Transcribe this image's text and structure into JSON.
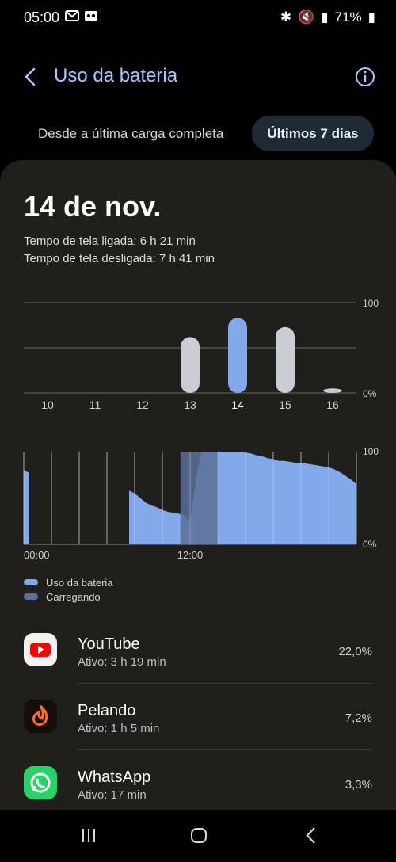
{
  "status": {
    "time": "05:00",
    "battery": "71%"
  },
  "header": {
    "title": "Uso da bateria",
    "icons": [
      "back-arrow-icon",
      "info-icon"
    ]
  },
  "tabs": [
    {
      "label": "Desde a última carga completa"
    },
    {
      "label": "Últimos 7 dias"
    }
  ],
  "summary": {
    "date": "14 de nov.",
    "screen_on": "Tempo de tela ligada: 6 h 21 min",
    "screen_off": "Tempo de tela desligada: 7 h 41 min"
  },
  "chart_data": [
    {
      "type": "bar",
      "categories": [
        "10",
        "11",
        "12",
        "13",
        "14",
        "15",
        "16"
      ],
      "values": [
        0,
        0,
        0,
        62,
        83,
        73,
        5
      ],
      "ylim": [
        0,
        100
      ],
      "y_tick_labels": [
        "100",
        "0%"
      ],
      "selected": "14",
      "colors": {
        "normal": "#c9ccd3",
        "selected": "#84a9ea"
      }
    },
    {
      "type": "area",
      "title": "",
      "x_tick_labels": [
        "00:00",
        "12:00"
      ],
      "y_tick_labels": [
        "100",
        "0%"
      ],
      "ylim": [
        0,
        100
      ],
      "x": [
        0,
        0.4,
        0.8,
        1.2,
        1.6,
        2,
        2.4,
        2.8,
        3.2,
        3.6,
        4,
        4.4,
        4.8,
        5.2,
        5.6,
        6,
        6.4,
        6.8,
        7.2,
        7.6,
        8,
        8.4,
        8.8,
        9.2,
        9.6,
        10,
        10.4,
        10.8,
        11.2,
        11.6,
        12,
        12.4,
        12.8,
        13.2,
        13.6,
        14,
        14.4,
        14.8,
        15.2,
        15.6,
        16,
        16.4,
        16.8,
        17.2,
        17.6,
        18,
        18.4,
        18.8,
        19.2,
        19.6,
        20,
        20.4,
        20.8,
        21.2,
        21.6,
        22,
        22.4,
        22.8,
        23.2,
        23.6,
        24
      ],
      "series": [
        {
          "values": [
            80,
            77,
            null,
            null,
            null,
            null,
            null,
            null,
            null,
            null,
            null,
            null,
            null,
            null,
            null,
            null,
            null,
            null,
            null,
            58,
            55,
            50,
            45,
            42,
            40,
            37,
            35,
            34,
            33,
            31,
            24,
            67,
            100,
            100,
            100,
            100,
            100,
            100,
            100,
            100,
            99,
            98,
            96,
            95,
            93,
            92,
            90,
            90,
            89,
            88,
            88,
            87,
            86,
            85,
            84,
            83,
            81,
            78,
            74,
            70,
            65
          ],
          "color": "#84a9ea"
        }
      ],
      "charging_ranges": [
        [
          11.3,
          14.0
        ]
      ],
      "colors": {
        "battery": "#84a9ea",
        "charging": "#5a7099"
      }
    }
  ],
  "legend": [
    {
      "label": "Uso da bateria",
      "color": "#84a9ea"
    },
    {
      "label": "Carregando",
      "color": "#5a7099"
    }
  ],
  "apps": [
    {
      "name": "YouTube",
      "active": "Ativo: 3 h 19 min",
      "percent": "22,0%",
      "icon": "youtube-icon"
    },
    {
      "name": "Pelando",
      "active": "Ativo: 1 h 5 min",
      "percent": "7,2%",
      "icon": "pelando-icon"
    },
    {
      "name": "WhatsApp",
      "active": "Ativo: 17 min",
      "percent": "3,3%",
      "icon": "whatsapp-icon"
    }
  ],
  "nav_icons": [
    "recents-icon",
    "home-icon",
    "back-icon"
  ]
}
